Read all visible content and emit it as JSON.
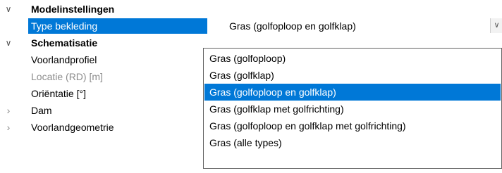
{
  "categories": {
    "modelinstellingen": "Modelinstellingen",
    "schematisatie": "Schematisatie"
  },
  "rows": {
    "type_bekleding": {
      "label": "Type bekleding",
      "value": "Gras (golfoploop en golfklap)"
    },
    "voorlandprofiel": {
      "label": "Voorlandprofiel"
    },
    "locatie": {
      "label": "Locatie (RD) [m]"
    },
    "orientatie": {
      "label": "Oriëntatie [°]"
    },
    "dam": {
      "label": "Dam"
    },
    "voorlandgeometrie": {
      "label": "Voorlandgeometrie"
    }
  },
  "dropdown": {
    "selected": "Gras (golfoploop en golfklap)",
    "options": [
      "Gras (golfoploop)",
      "Gras (golfklap)",
      "Gras (golfoploop en golfklap)",
      "Gras (golfklap met golfrichting)",
      "Gras (golfoploop en golfklap met golfrichting)",
      "Gras (alle types)"
    ]
  },
  "icons": {
    "expanded": "chevron-down",
    "collapsed": "chevron-right",
    "dropdown": "chevron-down"
  },
  "colors": {
    "selection": "#0078d7",
    "disabled_text": "#8c8c8c"
  }
}
